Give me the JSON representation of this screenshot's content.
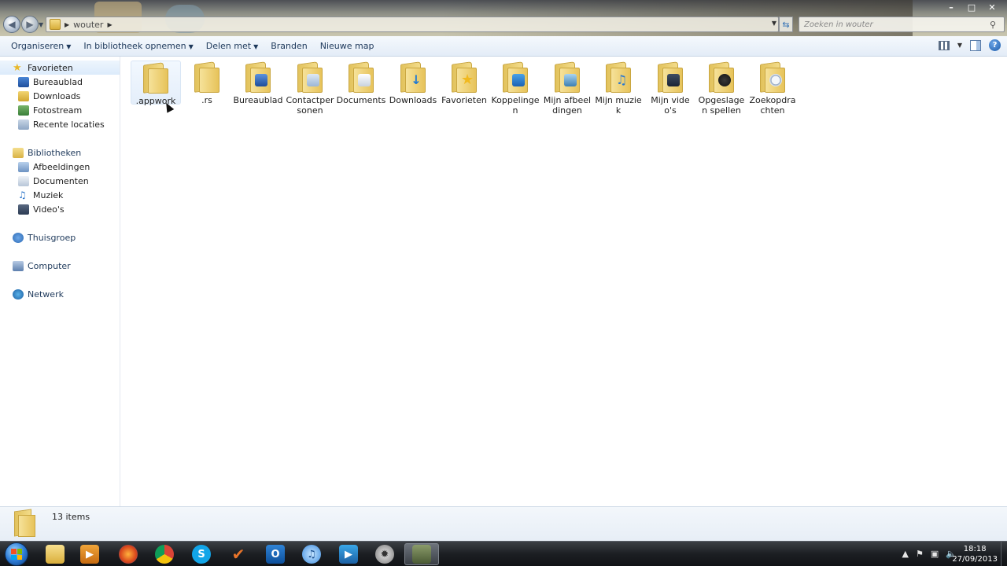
{
  "window": {
    "address_path": "wouter",
    "search_placeholder": "Zoeken in wouter",
    "controls": {
      "minimize": "–",
      "maximize": "□",
      "close": "✕"
    }
  },
  "command_bar": {
    "items": [
      "Organiseren",
      "In bibliotheek opnemen",
      "Delen met",
      "Branden",
      "Nieuwe map"
    ],
    "help": "?"
  },
  "nav_pane": {
    "favorites": {
      "header": "Favorieten",
      "items": [
        "Bureaublad",
        "Downloads",
        "Fotostream",
        "Recente locaties"
      ]
    },
    "libraries": {
      "header": "Bibliotheken",
      "items": [
        "Afbeeldingen",
        "Documenten",
        "Muziek",
        "Video's"
      ]
    },
    "homegroup": "Thuisgroep",
    "computer": "Computer",
    "network": "Netwerk"
  },
  "folders": [
    {
      "name": ".appwork",
      "icon": "folder-plain-icon"
    },
    {
      "name": ".rs",
      "icon": "folder-plain-icon"
    },
    {
      "name": "Bureaublad",
      "icon": "desktop-folder-icon"
    },
    {
      "name": "Contactpers​onen",
      "icon": "contacts-folder-icon"
    },
    {
      "name": "Documents",
      "icon": "documents-folder-icon"
    },
    {
      "name": "Downloads",
      "icon": "downloads-folder-icon"
    },
    {
      "name": "Favorieten",
      "icon": "favorites-folder-icon"
    },
    {
      "name": "Koppelinge​n",
      "icon": "links-folder-icon"
    },
    {
      "name": "Mijn afbeelding​en",
      "icon": "pictures-folder-icon"
    },
    {
      "name": "Mijn muziek",
      "icon": "music-folder-icon"
    },
    {
      "name": "Mijn video's",
      "icon": "videos-folder-icon"
    },
    {
      "name": "Opgeslage​n spellen",
      "icon": "saved-games-folder-icon"
    },
    {
      "name": "Zoekopdra​chten",
      "icon": "searches-folder-icon"
    }
  ],
  "details": {
    "item_count": "13 items"
  },
  "taskbar": {
    "apps": [
      "Verkenner",
      "Windows Media Player",
      "Firefox",
      "Chrome",
      "Skype",
      "Taken",
      "Outlook",
      "iTunes",
      "Media Player",
      "Video",
      "Spel"
    ],
    "clock_time": "18:18",
    "clock_date": "27/09/2013"
  }
}
